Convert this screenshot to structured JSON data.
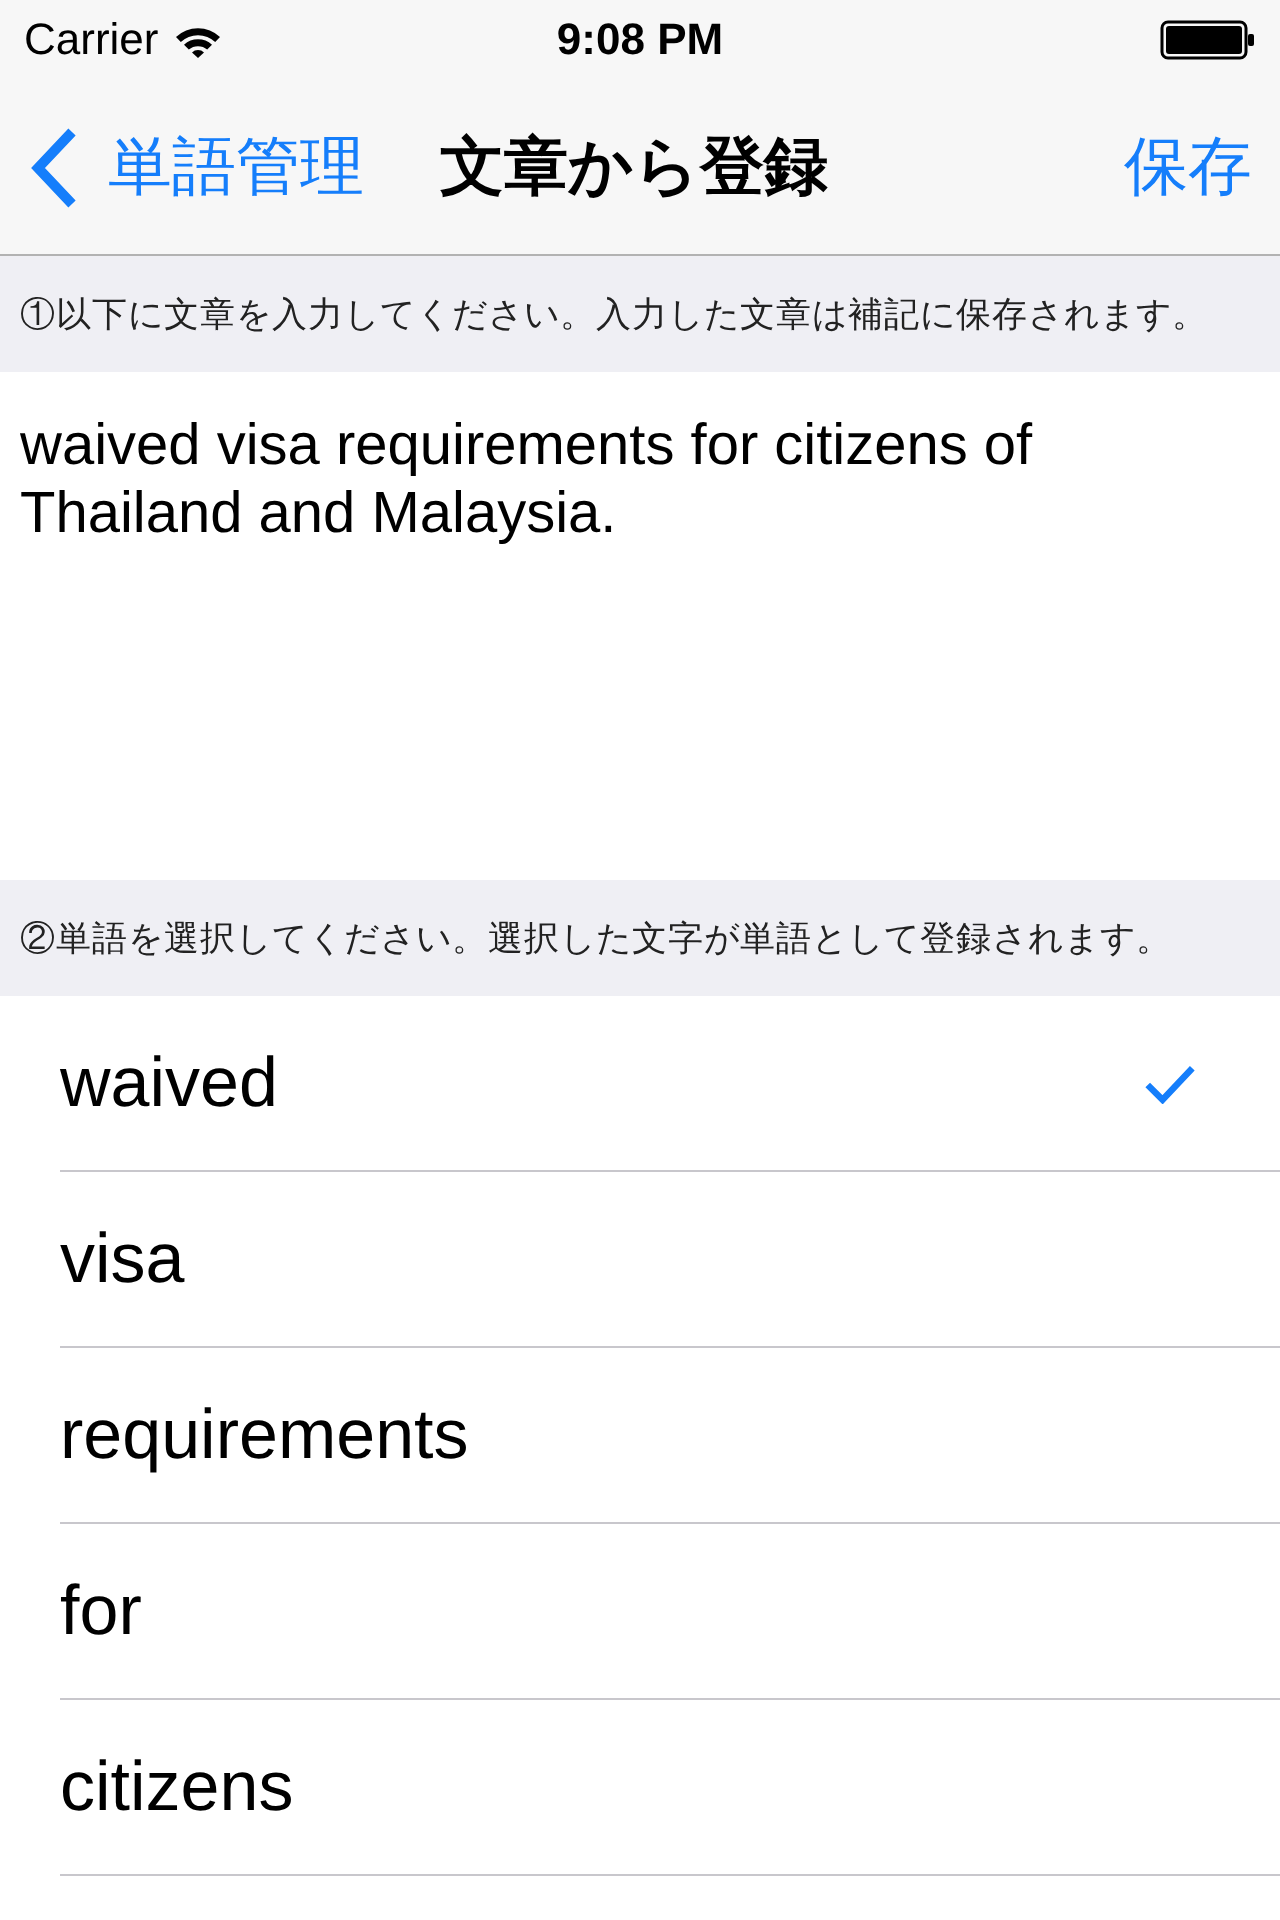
{
  "status_bar": {
    "carrier": "Carrier",
    "time": "9:08 PM"
  },
  "nav_bar": {
    "back": "単語管理",
    "title": "文章から登録",
    "action": "保存"
  },
  "sentence_section": {
    "header": "①以下に文章を入力してください。入力した文章は補記に保存されます。",
    "value": "waived visa requirements for citizens of Thailand and Malaysia."
  },
  "word_section": {
    "header": "②単語を選択してください。選択した文字が単語として登録されます。",
    "words": [
      {
        "label": "waived",
        "selected": true
      },
      {
        "label": "visa",
        "selected": false
      },
      {
        "label": "requirements",
        "selected": false
      },
      {
        "label": "for",
        "selected": false
      },
      {
        "label": "citizens",
        "selected": false
      }
    ]
  }
}
